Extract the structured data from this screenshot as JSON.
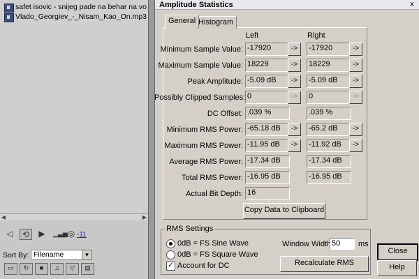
{
  "file_browser": {
    "files": [
      "safet isovic - snijeg pade na behar na vo",
      "Vlado_Georgiev_-_Nisam_Kao_On.mp3"
    ],
    "volume_label": "-11",
    "sort_label": "Sort By:",
    "sort_value": "Filename"
  },
  "dialog": {
    "title": "Amplitude Statistics",
    "close_glyph": "x",
    "tabs": [
      "General",
      "Histogram"
    ],
    "col_left": "Left",
    "col_right": "Right",
    "rows": [
      {
        "label": "Minimum Sample Value:",
        "left": "-17920",
        "right": "-17920"
      },
      {
        "label": "Maximum Sample Value:",
        "left": "18229",
        "right": "18229"
      },
      {
        "label": "Peak Amplitude:",
        "left": "-5.09 dB",
        "right": "-5.09 dB"
      },
      {
        "label": "Possibly Clipped Samples:",
        "left": "0",
        "right": "0"
      },
      {
        "label": "DC Offset:",
        "left": ".039 %",
        "right": ".039 %"
      },
      {
        "label": "Minimum RMS Power:",
        "left": "-65.18 dB",
        "right": "-65.2 dB"
      },
      {
        "label": "Maximum RMS Power:",
        "left": "-11.95 dB",
        "right": "-11.92 dB"
      },
      {
        "label": "Average RMS Power:",
        "left": "-17.34 dB",
        "right": "-17.34 dB"
      },
      {
        "label": "Total RMS Power:",
        "left": "-16.95 dB",
        "right": "-16.95 dB"
      },
      {
        "label": "Actual Bit Depth:",
        "left": "16",
        "right": ""
      }
    ],
    "go_glyph": "->",
    "copy_button": "Copy Data to Clipboard",
    "rms": {
      "legend": "RMS Settings",
      "option_sine": "0dB = FS Sine Wave",
      "option_square": "0dB = FS Square Wave",
      "account_dc": "Account for DC",
      "window_width_label": "Window Width:",
      "window_width_value": "50",
      "window_width_unit": "ms",
      "recalc_button": "Recalculate RMS"
    },
    "close_button": "Close",
    "help_button": "Help"
  }
}
